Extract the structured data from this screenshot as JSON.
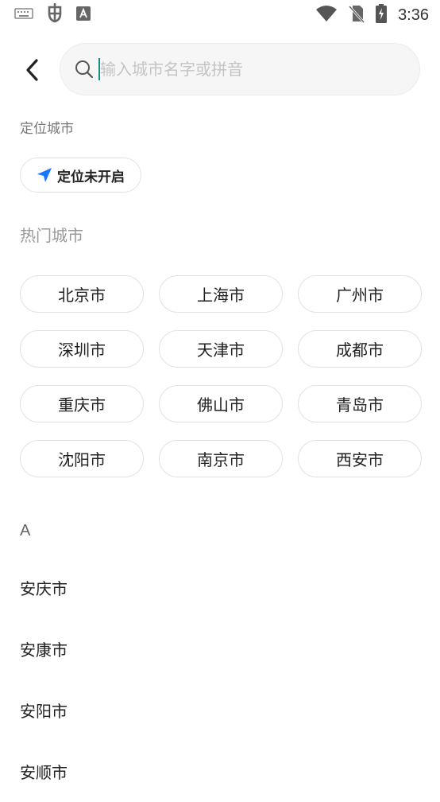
{
  "status_bar": {
    "time": "3:36",
    "left_icons": [
      "keyboard-icon",
      "app-bug-icon",
      "font-a-icon"
    ],
    "right_icons": [
      "wifi-icon",
      "no-sim-icon",
      "battery-charging-icon"
    ]
  },
  "search": {
    "placeholder": "输入城市名字或拼音",
    "value": ""
  },
  "location": {
    "section_label": "定位城市",
    "chip_label": "定位未开启",
    "accent_color": "#1677ff"
  },
  "hot": {
    "section_label": "热门城市",
    "cities": [
      "北京市",
      "上海市",
      "广州市",
      "深圳市",
      "天津市",
      "成都市",
      "重庆市",
      "佛山市",
      "青岛市",
      "沈阳市",
      "南京市",
      "西安市"
    ]
  },
  "index": {
    "letter": "A",
    "cities": [
      "安庆市",
      "安康市",
      "安阳市",
      "安顺市"
    ]
  }
}
